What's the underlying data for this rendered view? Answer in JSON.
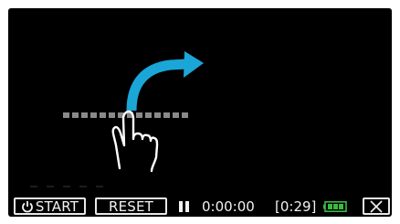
{
  "toolbar": {
    "start_label": "START",
    "start_icon": "power-icon",
    "reset_label": "RESET",
    "pause_icon": "pause-icon",
    "elapsed_time": "0:00:00",
    "remaining_time": "[0:29]",
    "battery_icon": "battery-icon",
    "battery_level": 1.0,
    "close_icon": "close-icon"
  },
  "illustration": {
    "dotted_line_icon": "dotted-line",
    "arrow_icon": "curved-arrow-icon",
    "hand_icon": "pointing-hand-icon",
    "colors": {
      "background": "#000000",
      "arrow": "#1ba6d8",
      "dots": "#8a8a8a",
      "battery": "#3cb843",
      "text": "#f2f2f2"
    }
  }
}
